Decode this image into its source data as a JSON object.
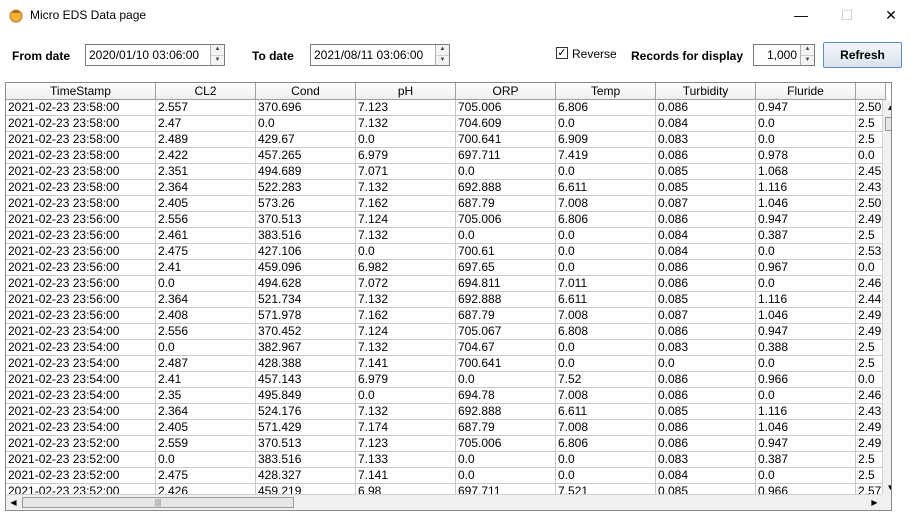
{
  "window": {
    "title": "Micro EDS Data page",
    "minimize_glyph": "—",
    "maximize_glyph": "☐",
    "close_glyph": "✕"
  },
  "toolbar": {
    "from_label": "From date",
    "from_value": "2020/01/10 03:06:00",
    "to_label": "To date",
    "to_value": "2021/08/11 03:06:00",
    "reverse_label": "Reverse",
    "reverse_checked": "✓",
    "records_label": "Records for display",
    "records_value": "1,000",
    "refresh_label": "Refresh"
  },
  "icons": {
    "spin_up": "▲",
    "spin_down": "▼",
    "scroll_up": "▲",
    "scroll_down": "▼",
    "scroll_left": "◀",
    "scroll_right": "▶",
    "thumb_grip": "|||"
  },
  "table": {
    "columns": [
      "TimeStamp",
      "CL2",
      "Cond",
      "pH",
      "ORP",
      "Temp",
      "Turbidity",
      "Fluride",
      ""
    ],
    "rows": [
      [
        "2021-02-23 23:58:00",
        "2.557",
        "370.696",
        "7.123",
        "705.006",
        "6.806",
        "0.086",
        "0.947",
        "2.50"
      ],
      [
        "2021-02-23 23:58:00",
        "2.47",
        "0.0",
        "7.132",
        "704.609",
        "0.0",
        "0.084",
        "0.0",
        "2.5"
      ],
      [
        "2021-02-23 23:58:00",
        "2.489",
        "429.67",
        "0.0",
        "700.641",
        "6.909",
        "0.083",
        "0.0",
        "2.5"
      ],
      [
        "2021-02-23 23:58:00",
        "2.422",
        "457.265",
        "6.979",
        "697.711",
        "7.419",
        "0.086",
        "0.978",
        "0.0"
      ],
      [
        "2021-02-23 23:58:00",
        "2.351",
        "494.689",
        "7.071",
        "0.0",
        "0.0",
        "0.085",
        "1.068",
        "2.45"
      ],
      [
        "2021-02-23 23:58:00",
        "2.364",
        "522.283",
        "7.132",
        "692.888",
        "6.611",
        "0.085",
        "1.116",
        "2.43"
      ],
      [
        "2021-02-23 23:58:00",
        "2.405",
        "573.26",
        "7.162",
        "687.79",
        "7.008",
        "0.087",
        "1.046",
        "2.50"
      ],
      [
        "2021-02-23 23:56:00",
        "2.556",
        "370.513",
        "7.124",
        "705.006",
        "6.806",
        "0.086",
        "0.947",
        "2.49"
      ],
      [
        "2021-02-23 23:56:00",
        "2.461",
        "383.516",
        "7.132",
        "0.0",
        "0.0",
        "0.084",
        "0.387",
        "2.5"
      ],
      [
        "2021-02-23 23:56:00",
        "2.475",
        "427.106",
        "0.0",
        "700.61",
        "0.0",
        "0.084",
        "0.0",
        "2.53"
      ],
      [
        "2021-02-23 23:56:00",
        "2.41",
        "459.096",
        "6.982",
        "697.65",
        "0.0",
        "0.086",
        "0.967",
        "0.0"
      ],
      [
        "2021-02-23 23:56:00",
        "0.0",
        "494.628",
        "7.072",
        "694.811",
        "7.011",
        "0.086",
        "0.0",
        "2.46"
      ],
      [
        "2021-02-23 23:56:00",
        "2.364",
        "521.734",
        "7.132",
        "692.888",
        "6.611",
        "0.085",
        "1.116",
        "2.44"
      ],
      [
        "2021-02-23 23:56:00",
        "2.408",
        "571.978",
        "7.162",
        "687.79",
        "7.008",
        "0.087",
        "1.046",
        "2.49"
      ],
      [
        "2021-02-23 23:54:00",
        "2.556",
        "370.452",
        "7.124",
        "705.067",
        "6.808",
        "0.086",
        "0.947",
        "2.49"
      ],
      [
        "2021-02-23 23:54:00",
        "0.0",
        "382.967",
        "7.132",
        "704.67",
        "0.0",
        "0.083",
        "0.388",
        "2.5"
      ],
      [
        "2021-02-23 23:54:00",
        "2.487",
        "428.388",
        "7.141",
        "700.641",
        "0.0",
        "0.0",
        "0.0",
        "2.5"
      ],
      [
        "2021-02-23 23:54:00",
        "2.41",
        "457.143",
        "6.979",
        "0.0",
        "7.52",
        "0.086",
        "0.966",
        "0.0"
      ],
      [
        "2021-02-23 23:54:00",
        "2.35",
        "495.849",
        "0.0",
        "694.78",
        "7.008",
        "0.086",
        "0.0",
        "2.46"
      ],
      [
        "2021-02-23 23:54:00",
        "2.364",
        "524.176",
        "7.132",
        "692.888",
        "6.611",
        "0.085",
        "1.116",
        "2.43"
      ],
      [
        "2021-02-23 23:54:00",
        "2.405",
        "571.429",
        "7.174",
        "687.79",
        "7.008",
        "0.086",
        "1.046",
        "2.49"
      ],
      [
        "2021-02-23 23:52:00",
        "2.559",
        "370.513",
        "7.123",
        "705.006",
        "6.806",
        "0.086",
        "0.947",
        "2.49"
      ],
      [
        "2021-02-23 23:52:00",
        "0.0",
        "383.516",
        "7.133",
        "0.0",
        "0.0",
        "0.083",
        "0.387",
        "2.5"
      ],
      [
        "2021-02-23 23:52:00",
        "2.475",
        "428.327",
        "7.141",
        "0.0",
        "0.0",
        "0.084",
        "0.0",
        "2.5"
      ],
      [
        "2021-02-23 23:52:00",
        "2.426",
        "459.219",
        "6.98",
        "697.711",
        "7.521",
        "0.085",
        "0.966",
        "2.57"
      ]
    ]
  }
}
